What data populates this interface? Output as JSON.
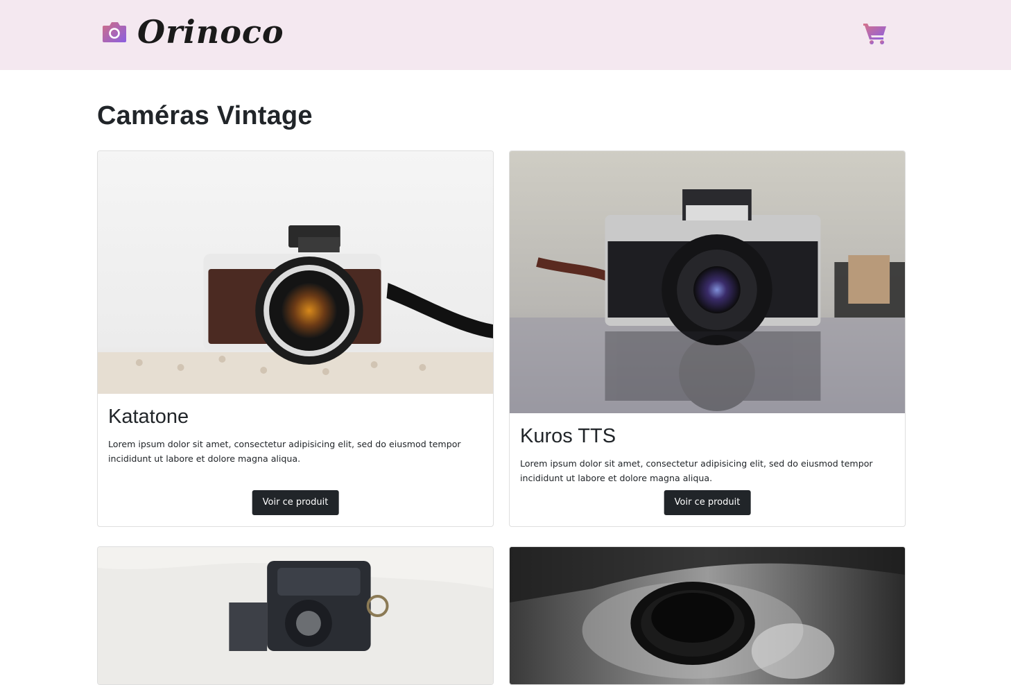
{
  "navbar": {
    "brand_text": "Orinoco",
    "accent_from": "#c86a8a",
    "accent_to": "#8e5bd8"
  },
  "page": {
    "title": "Caméras Vintage"
  },
  "products": [
    {
      "name": "Katatone",
      "description": "Lorem ipsum dolor sit amet, consectetur adipisicing elit, sed do eiusmod tempor incididunt ut labore et dolore magna aliqua.",
      "button_label": "Voir ce produit"
    },
    {
      "name": "Kuros TTS",
      "description": "Lorem ipsum dolor sit amet, consectetur adipisicing elit, sed do eiusmod tempor incididunt ut labore et dolore magna aliqua.",
      "button_label": "Voir ce produit"
    },
    {
      "name": "",
      "description": "",
      "button_label": ""
    },
    {
      "name": "",
      "description": "",
      "button_label": ""
    }
  ]
}
